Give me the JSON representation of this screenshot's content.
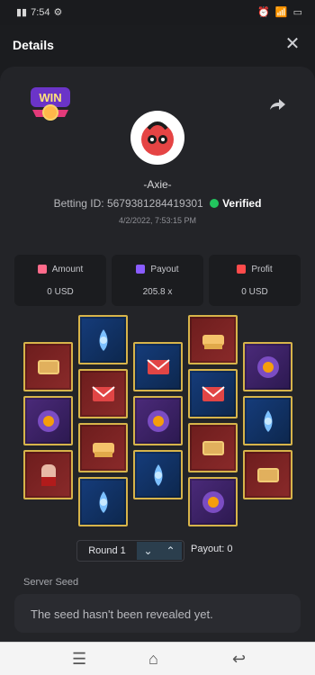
{
  "status_bar": {
    "time": "7:54"
  },
  "header": {
    "title": "Details",
    "close_label": "✕"
  },
  "profile": {
    "username": "-Axie-",
    "betting_id_label": "Betting ID:",
    "betting_id": "5679381284419301",
    "verified_label": "Verified",
    "timestamp": "4/2/2022, 7:53:15 PM"
  },
  "stats": [
    {
      "label": "Amount",
      "value": "0 USD"
    },
    {
      "label": "Payout",
      "value": "205.8 x"
    },
    {
      "label": "Profit",
      "value": "0 USD"
    }
  ],
  "round": {
    "label": "Round 1",
    "payout_label": "Payout:",
    "payout_value": "0"
  },
  "server_seed": {
    "label": "Server Seed",
    "text": "The seed hasn't been revealed yet."
  },
  "accent_colors": {
    "gold": "#d7b44a",
    "green": "#22c55e"
  }
}
